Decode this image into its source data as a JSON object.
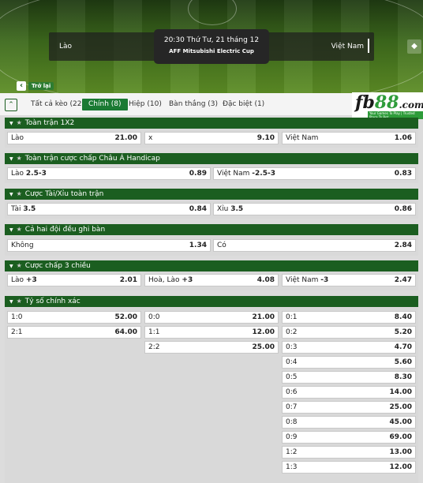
{
  "match": {
    "time": "20:30 Thứ Tư, 21 tháng 12",
    "league": "AFF Mitsubishi Electric Cup",
    "home": "Lào",
    "away": "Việt Nam",
    "back_label": "Trở lại"
  },
  "tabs": [
    {
      "label": "Tất cả kèo (22)"
    },
    {
      "label": "Chính (8)"
    },
    {
      "label": "Hiệp (10)"
    },
    {
      "label": "Bàn thắng (3)"
    },
    {
      "label": "Đặc biệt (1)"
    }
  ],
  "logo": {
    "fb": "fb",
    "num": "88",
    "dom": ".com",
    "tag": "Your Games To Play | Trusted Place To Bet"
  },
  "sections": [
    {
      "title": "Toàn trận 1X2",
      "cells": [
        {
          "label": "Lào",
          "value": "21.00"
        },
        {
          "label": "x",
          "value": "9.10"
        },
        {
          "label": "Việt Nam",
          "value": "1.06"
        }
      ]
    },
    {
      "title": "Toàn trận cược chấp Châu Á Handicap",
      "cells": [
        {
          "label": "Lào",
          "hc": "2.5-3",
          "value": "0.89"
        },
        {
          "label": "Việt Nam",
          "hc": "-2.5-3",
          "value": "0.83"
        }
      ]
    },
    {
      "title": "Cược Tài/Xỉu toàn trận",
      "cells": [
        {
          "label": "Tài",
          "hc": "3.5",
          "value": "0.84"
        },
        {
          "label": "Xỉu",
          "hc": "3.5",
          "value": "0.86"
        }
      ]
    },
    {
      "title": "Cả hai đội đều ghi bàn",
      "cells": [
        {
          "label": "Không",
          "value": "1.34"
        },
        {
          "label": "Có",
          "value": "2.84"
        }
      ]
    },
    {
      "title": "Cược chấp 3 chiều",
      "cells": [
        {
          "label": "Lào",
          "hc": "+3",
          "value": "2.01"
        },
        {
          "label": "Hoà, Lào",
          "hc": "+3",
          "value": "4.08"
        },
        {
          "label": "Việt Nam",
          "hc": "-3",
          "value": "2.47"
        }
      ]
    },
    {
      "title": "Tỷ số chính xác",
      "col1": [
        {
          "label": "1:0",
          "value": "52.00"
        },
        {
          "label": "2:1",
          "value": "64.00"
        }
      ],
      "col2": [
        {
          "label": "0:0",
          "value": "21.00"
        },
        {
          "label": "1:1",
          "value": "12.00"
        },
        {
          "label": "2:2",
          "value": "25.00"
        }
      ],
      "col3": [
        {
          "label": "0:1",
          "value": "8.40"
        },
        {
          "label": "0:2",
          "value": "5.20"
        },
        {
          "label": "0:3",
          "value": "4.70"
        },
        {
          "label": "0:4",
          "value": "5.60"
        },
        {
          "label": "0:5",
          "value": "8.30"
        },
        {
          "label": "0:6",
          "value": "14.00"
        },
        {
          "label": "0:7",
          "value": "25.00"
        },
        {
          "label": "0:8",
          "value": "45.00"
        },
        {
          "label": "0:9",
          "value": "69.00"
        },
        {
          "label": "1:2",
          "value": "13.00"
        },
        {
          "label": "1:3",
          "value": "12.00"
        }
      ]
    }
  ]
}
